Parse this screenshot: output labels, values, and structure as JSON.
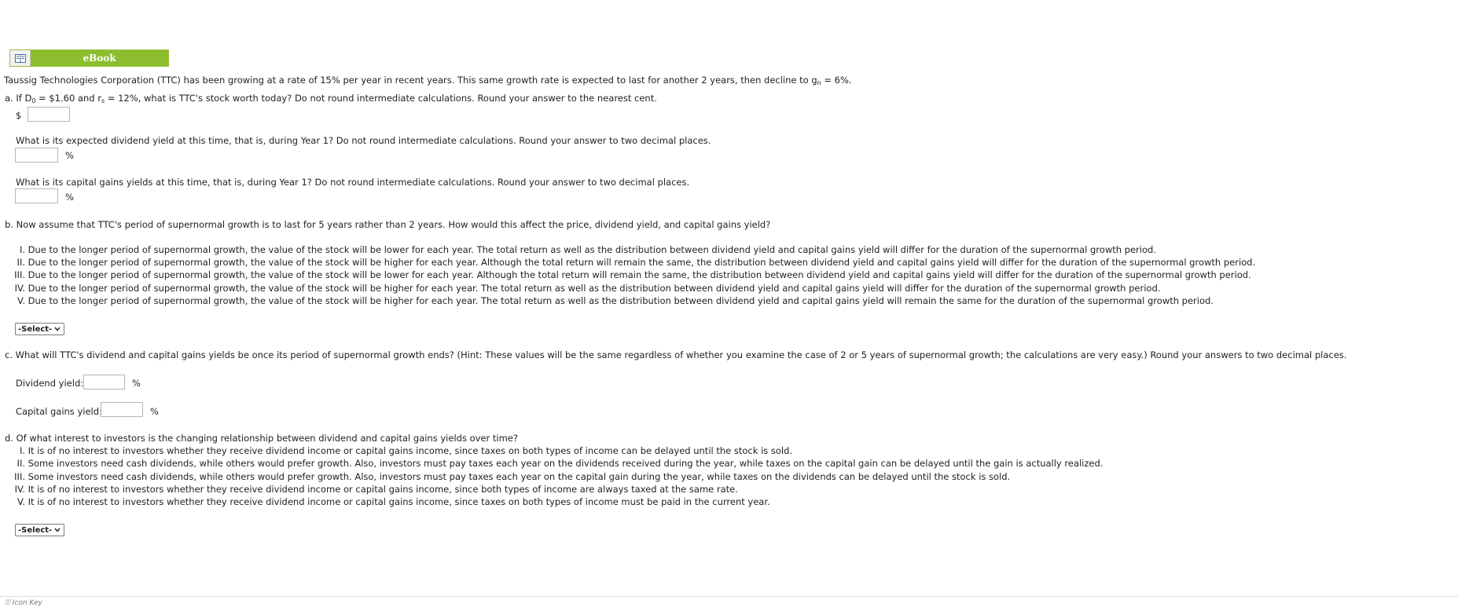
{
  "ebook": {
    "label": "eBook"
  },
  "intro": {
    "text": "Taussig Technologies Corporation (TTC) has been growing at a rate of 15% per year in recent years. This same growth rate is expected to last for another 2 years, then decline to g",
    "sub": "n",
    "suffix": " = 6%."
  },
  "part_a": {
    "q_pre": "a. If D",
    "q_sub1": "0",
    "q_mid": " = $1.60 and r",
    "q_sub2": "s",
    "q_post": " = 12%, what is TTC's stock worth today? Do not round intermediate calculations. Round your answer to the nearest cent.",
    "currency": "$",
    "dividend_q": "What is its expected dividend yield at this time, that is, during Year 1? Do not round intermediate calculations. Round your answer to two decimal places.",
    "capital_q": "What is its capital gains yields at this time, that is, during Year 1? Do not round intermediate calculations. Round your answer to two decimal places.",
    "pct": "%"
  },
  "part_b": {
    "question": "b. Now assume that TTC's period of supernormal growth is to last for 5 years rather than 2 years. How would this affect the price, dividend yield, and capital gains yield?",
    "options": [
      {
        "num": "I.",
        "text": "Due to the longer period of supernormal growth, the value of the stock will be lower for each year. The total return as well as the distribution between dividend yield and capital gains yield will differ for the duration of the supernormal growth period."
      },
      {
        "num": "II.",
        "text": "Due to the longer period of supernormal growth, the value of the stock will be higher for each year. Although the total return will remain the same, the distribution between dividend yield and capital gains yield will differ for the duration of the supernormal growth period."
      },
      {
        "num": "III.",
        "text": "Due to the longer period of supernormal growth, the value of the stock will be lower for each year. Although the total return will remain the same, the distribution between dividend yield and capital gains yield will differ for the duration of the supernormal growth period."
      },
      {
        "num": "IV.",
        "text": "Due to the longer period of supernormal growth, the value of the stock will be higher for each year. The total return as well as the distribution between dividend yield and capital gains yield will differ for the duration of the supernormal growth period."
      },
      {
        "num": "V.",
        "text": "Due to the longer period of supernormal growth, the value of the stock will be higher for each year. The total return as well as the distribution between dividend yield and capital gains yield will remain the same for the duration of the supernormal growth period."
      }
    ],
    "select_value": "-Select-"
  },
  "part_c": {
    "question": "c. What will TTC's dividend and capital gains yields be once its period of supernormal growth ends? (Hint: These values will be the same regardless of whether you examine the case of 2 or 5 years of supernormal growth; the calculations are very easy.) Round your answers to two decimal places.",
    "dividend_label": "Dividend yield:",
    "capital_label": "Capital gains yield:",
    "pct": "%"
  },
  "part_d": {
    "question": "d. Of what interest to investors is the changing relationship between dividend and capital gains yields over time?",
    "options": [
      {
        "num": "I.",
        "text": "It is of no interest to investors whether they receive dividend income or capital gains income, since taxes on both types of income can be delayed until the stock is sold."
      },
      {
        "num": "II.",
        "text": "Some investors need cash dividends, while others would prefer growth. Also, investors must pay taxes each year on the dividends received during the year, while taxes on the capital gain can be delayed until the gain is actually realized."
      },
      {
        "num": "III.",
        "text": "Some investors need cash dividends, while others would prefer growth. Also, investors must pay taxes each year on the capital gain during the year, while taxes on the dividends can be delayed until the stock is sold."
      },
      {
        "num": "IV.",
        "text": "It is of no interest to investors whether they receive dividend income or capital gains income, since both types of income are always taxed at the same rate."
      },
      {
        "num": "V.",
        "text": "It is of no interest to investors whether they receive dividend income or capital gains income, since taxes on both types of income must be paid in the current year."
      }
    ],
    "select_value": "-Select-"
  },
  "footer": {
    "label": "Icon Key"
  }
}
